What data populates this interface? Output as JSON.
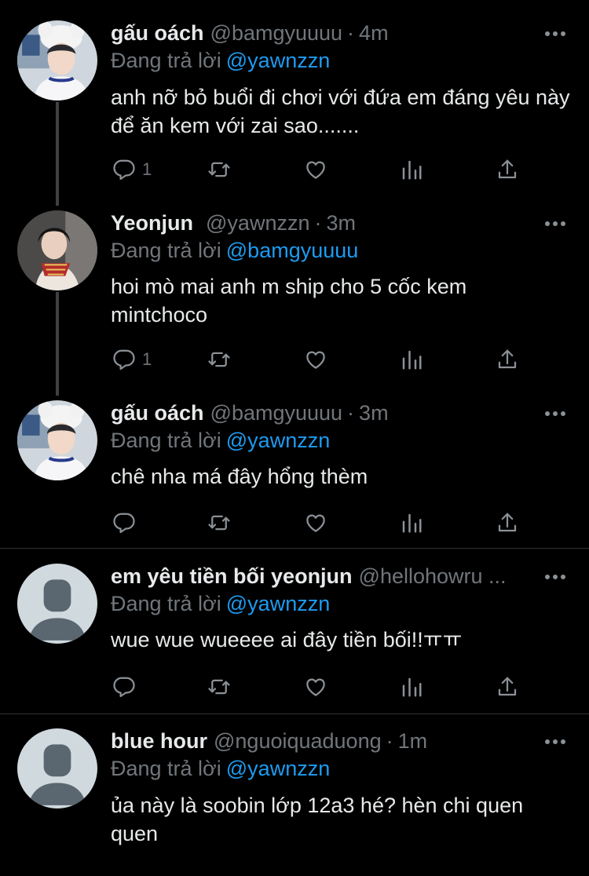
{
  "tweets": [
    {
      "name": "gấu oách",
      "handle": "@bamgyuuuu",
      "time": "4m",
      "reply_label": "Đang trả lời",
      "reply_to": "@yawnzzn",
      "text": "anh nỡ bỏ buổi đi chơi với đứa em đáng yêu này để ăn kem với zai sao.......",
      "reply_count": "1"
    },
    {
      "name": "Yeonjun",
      "handle": "@yawnzzn",
      "time": "3m",
      "reply_label": "Đang trả lời",
      "reply_to": "@bamgyuuuu",
      "text": "hoi mò mai anh m ship cho 5 cốc kem mintchoco",
      "reply_count": "1"
    },
    {
      "name": "gấu oách",
      "handle": "@bamgyuuuu",
      "time": "3m",
      "reply_label": "Đang trả lời",
      "reply_to": "@yawnzzn",
      "text": "chê nha má đây hổng thèm",
      "reply_count": ""
    },
    {
      "name": "em yêu tiền bối yeonjun",
      "handle": "@hellohowru ...",
      "time": "",
      "reply_label": "Đang trả lời",
      "reply_to": "@yawnzzn",
      "text": "wue wue wueeee ai đây tiền bối!!ㅠㅠ",
      "reply_count": ""
    },
    {
      "name": "blue hour",
      "handle": "@nguoiquaduong",
      "time": "1m",
      "reply_label": "Đang trả lời",
      "reply_to": "@yawnzzn",
      "text": "ủa này là soobin lớp 12a3 hé? hèn chi quen quen",
      "reply_count": ""
    }
  ],
  "separator": "·",
  "colors": {
    "background": "#000000",
    "text": "#e7e9ea",
    "muted": "#71767b",
    "link": "#1d9bf0",
    "divider": "#2f3336"
  },
  "icons": {
    "reply": "reply-icon",
    "retweet": "retweet-icon",
    "like": "like-icon",
    "views": "views-icon",
    "share": "share-icon",
    "more": "more-icon"
  }
}
